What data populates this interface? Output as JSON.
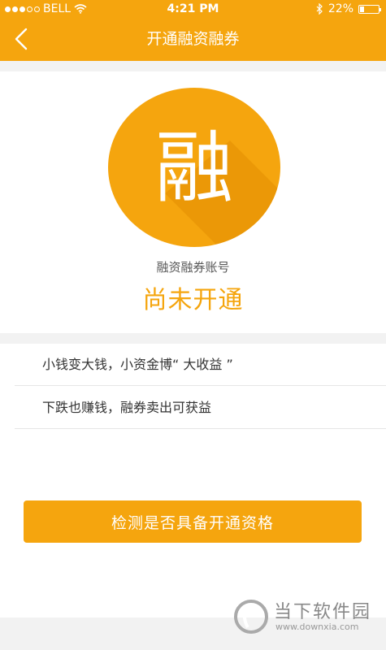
{
  "status_bar": {
    "carrier": "BELL",
    "time": "4:21 PM",
    "battery": "22%",
    "signal_dots_filled": 3,
    "signal_dots_total": 5
  },
  "nav": {
    "title": "开通融资融券",
    "back_icon": "chevron-left-icon"
  },
  "hero": {
    "logo_char": "融",
    "account_label": "融资融券账号",
    "account_status": "尚未开通"
  },
  "features": {
    "items": [
      {
        "text": "小钱变大钱，小资金博“ 大收益 ”"
      },
      {
        "text": "下跌也赚钱，融券卖出可获益"
      }
    ]
  },
  "actions": {
    "check_label": "检测是否具备开通资格"
  },
  "watermark": {
    "text": "当下软件园",
    "url": "www.downxia.com"
  },
  "colors": {
    "accent": "#f5a50e",
    "accent_shadow": "#e08a00",
    "page_bg": "#f2f2f2"
  }
}
